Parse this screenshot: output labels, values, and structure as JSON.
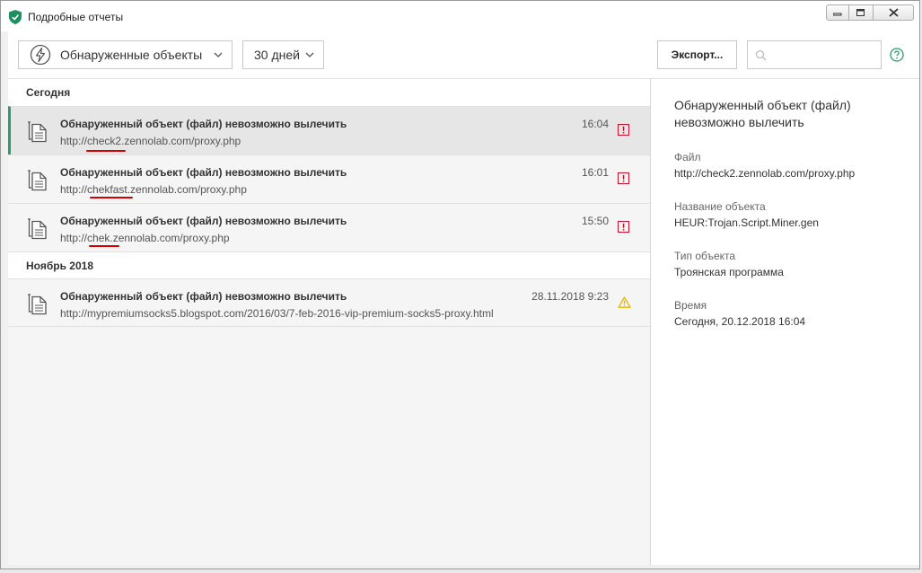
{
  "window": {
    "title": "Подробные отчеты"
  },
  "toolbar": {
    "category_label": "Обнаруженные объекты",
    "period_label": "30 дней",
    "export_label": "Экспорт...",
    "search_placeholder": "",
    "search_value": ""
  },
  "groups": [
    {
      "header": "Сегодня",
      "rows": [
        {
          "title": "Обнаруженный объект (файл) невозможно вылечить",
          "url": "http://check2.zennolab.com/proxy.php",
          "time": "16:04",
          "status_icon": "danger-icon"
        },
        {
          "title": "Обнаруженный объект (файл) невозможно вылечить",
          "url": "http://chekfast.zennolab.com/proxy.php",
          "time": "16:01",
          "status_icon": "danger-icon"
        },
        {
          "title": "Обнаруженный объект (файл) невозможно вылечить",
          "url": "http://chek.zennolab.com/proxy.php",
          "time": "15:50",
          "status_icon": "danger-icon"
        }
      ]
    },
    {
      "header": "Ноябрь 2018",
      "rows": [
        {
          "title": "Обнаруженный объект (файл) невозможно вылечить",
          "url": "http://mypremiumsocks5.blogspot.com/2016/03/7-feb-2016-vip-premium-socks5-proxy.html",
          "time": "28.11.2018 9:23",
          "status_icon": "warning-icon"
        }
      ]
    }
  ],
  "details": {
    "title": "Обнаруженный объект (файл) невозможно вылечить",
    "file_label": "Файл",
    "file_value": "http://check2.zennolab.com/proxy.php",
    "object_name_label": "Название объекта",
    "object_name_value": "HEUR:Trojan.Script.Miner.gen",
    "object_type_label": "Тип объекта",
    "object_type_value": "Троянская программа",
    "time_label": "Время",
    "time_value": "Сегодня, 20.12.2018 16:04"
  },
  "colors": {
    "accent": "#2a9d6e",
    "danger": "#c8102e",
    "warning": "#e8b400",
    "annotation": "#d40000"
  }
}
